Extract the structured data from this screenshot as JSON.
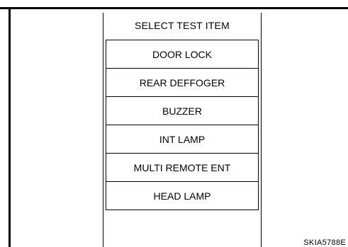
{
  "screen": {
    "title": "SELECT TEST ITEM",
    "items": [
      {
        "label": "DOOR LOCK"
      },
      {
        "label": "REAR DEFFOGER"
      },
      {
        "label": "BUZZER"
      },
      {
        "label": "INT LAMP"
      },
      {
        "label": "MULTI REMOTE ENT"
      },
      {
        "label": "HEAD LAMP"
      }
    ]
  },
  "figure": {
    "id": "SKIA5788E"
  }
}
